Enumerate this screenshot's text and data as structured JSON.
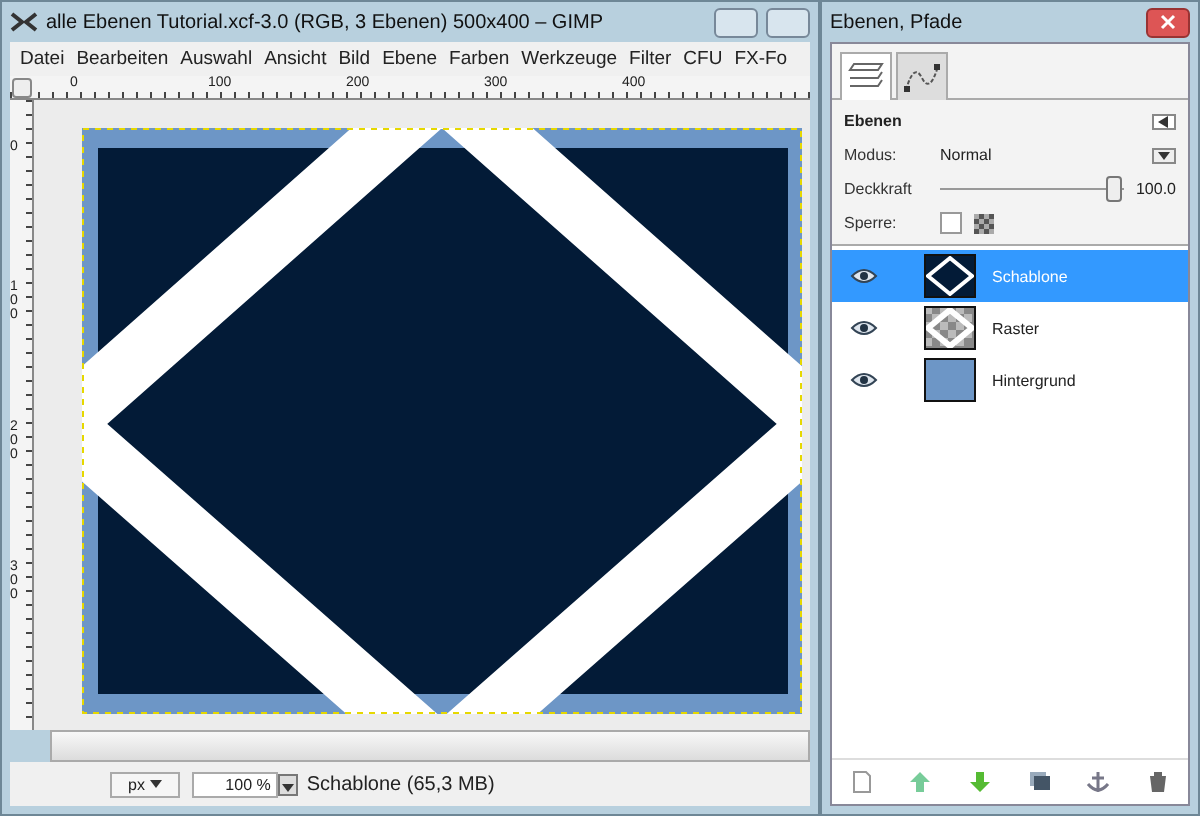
{
  "window": {
    "title": "alle Ebenen Tutorial.xcf-3.0 (RGB, 3 Ebenen) 500x400 – GIMP"
  },
  "menu": [
    "Datei",
    "Bearbeiten",
    "Auswahl",
    "Ansicht",
    "Bild",
    "Ebene",
    "Farben",
    "Werkzeuge",
    "Filter",
    "CFU",
    "FX-Fo"
  ],
  "rulers": {
    "horizontal": [
      "0",
      "100",
      "200",
      "300",
      "400"
    ],
    "vertical": [
      "0",
      "100",
      "200",
      "300"
    ]
  },
  "status_bar": {
    "unit": "px",
    "zoom": "100 %",
    "info": "Schablone (65,3 MB)"
  },
  "dock": {
    "title": "Ebenen, Pfade",
    "tabs": [
      {
        "kind": "layers",
        "selected": true
      },
      {
        "kind": "paths",
        "selected": false
      }
    ],
    "panel_title": "Ebenen",
    "mode_label": "Modus:",
    "mode": "Normal",
    "opacity_label": "Deckkraft",
    "opacity": {
      "level": 0.97
    },
    "opacity_value": "100.0",
    "lock_label": "Sperre:",
    "lock_checked": false,
    "layers": [
      {
        "name": "Schablone",
        "kind": "stencil",
        "visible": true,
        "selected": true
      },
      {
        "name": "Raster",
        "kind": "raster",
        "visible": true,
        "selected": false
      },
      {
        "name": "Hintergrund",
        "kind": "background",
        "visible": true,
        "selected": false
      }
    ]
  }
}
